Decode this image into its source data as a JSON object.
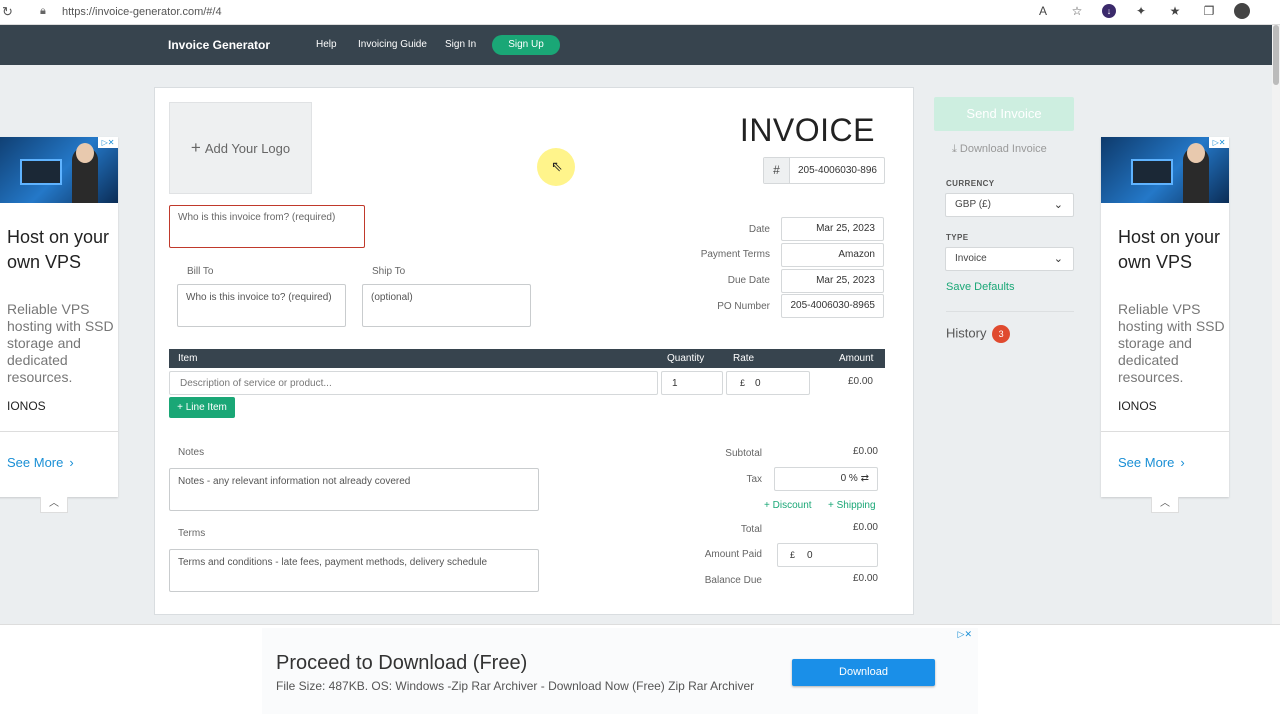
{
  "browser": {
    "url": "https://invoice-generator.com/#/4",
    "icons": [
      "reload-icon",
      "lock-icon",
      "read-aloud-icon",
      "favorite-icon",
      "vpn-icon",
      "extensions-icon",
      "favorites-bar-icon",
      "collections-icon",
      "profile-icon"
    ]
  },
  "nav": {
    "brand": "Invoice Generator",
    "links": [
      "Help",
      "Invoicing Guide",
      "Sign In"
    ],
    "signup": "Sign Up"
  },
  "side_ads": {
    "title": "Host on your own VPS",
    "desc": "Reliable VPS hosting with SSD storage and dedicated resources.",
    "brand": "IONOS",
    "more": "See More"
  },
  "invoice": {
    "add_logo": "Add Your Logo",
    "title": "INVOICE",
    "number_prefix": "#",
    "number": "205-4006030-896",
    "from_placeholder": "Who is this invoice from? (required)",
    "bill_to_label": "Bill To",
    "bill_to_placeholder": "Who is this invoice to? (required)",
    "ship_to_label": "Ship To",
    "ship_to_placeholder": "(optional)",
    "meta": {
      "date_label": "Date",
      "date": "Mar 25, 2023",
      "terms_label": "Payment Terms",
      "terms": "Amazon",
      "due_label": "Due Date",
      "due": "Mar 25, 2023",
      "po_label": "PO Number",
      "po": "205-4006030-8965"
    },
    "items_header": {
      "item": "Item",
      "quantity": "Quantity",
      "rate": "Rate",
      "amount": "Amount"
    },
    "item": {
      "desc_placeholder": "Description of service or product...",
      "qty": "1",
      "currency": "£",
      "rate": "0",
      "amount": "£0.00"
    },
    "line_item_btn": "Line Item",
    "notes_label": "Notes",
    "notes_placeholder": "Notes - any relevant information not already covered",
    "terms_label": "Terms",
    "terms_placeholder": "Terms and conditions - late fees, payment methods, delivery schedule",
    "totals": {
      "subtotal_label": "Subtotal",
      "subtotal": "£0.00",
      "tax_label": "Tax",
      "tax": "0 %",
      "discount": "Discount",
      "shipping": "Shipping",
      "total_label": "Total",
      "total": "£0.00",
      "paid_label": "Amount Paid",
      "paid_currency": "£",
      "paid": "0",
      "balance_label": "Balance Due",
      "balance": "£0.00"
    }
  },
  "panel": {
    "send": "Send Invoice",
    "download": "Download Invoice",
    "currency_label": "CURRENCY",
    "currency": "GBP (£)",
    "type_label": "TYPE",
    "type": "Invoice",
    "save_defaults": "Save Defaults",
    "history": "History",
    "history_count": "3"
  },
  "bottom_ad": {
    "title": "Proceed to Download (Free)",
    "sub": "File Size: 487KB. OS: Windows -Zip Rar Archiver - Download Now (Free) Zip Rar Archiver",
    "button": "Download"
  }
}
